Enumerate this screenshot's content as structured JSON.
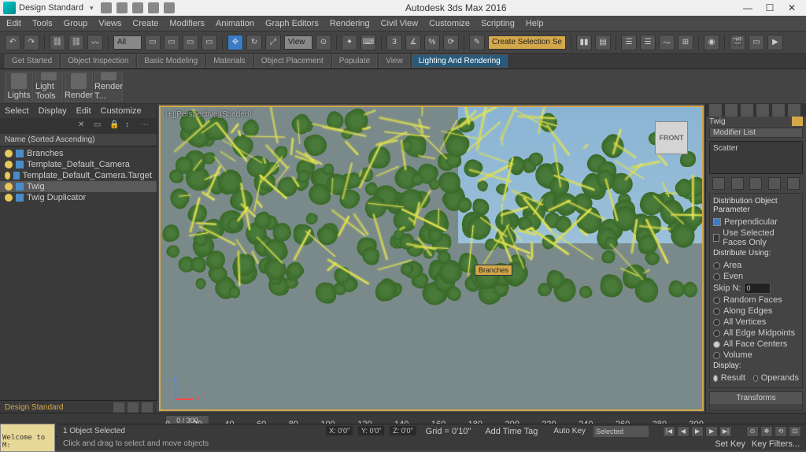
{
  "titlebar": {
    "workspace": "Design Standard",
    "title": "Autodesk 3ds Max 2016"
  },
  "menus": [
    "Edit",
    "Tools",
    "Group",
    "Views",
    "Create",
    "Modifiers",
    "Animation",
    "Graph Editors",
    "Rendering",
    "Civil View",
    "Customize",
    "Scripting",
    "Help"
  ],
  "toolbar": {
    "all": "All",
    "view": "View",
    "selset": "Create Selection Se"
  },
  "tabs": [
    "Get Started",
    "Object Inspection",
    "Basic Modeling",
    "Materials",
    "Object Placement",
    "Populate",
    "View",
    "Lighting And Rendering"
  ],
  "active_tab": "Lighting And Rendering",
  "ribbon": [
    "Lights",
    "Light Tools",
    "Render",
    "Render T..."
  ],
  "leftmenus": [
    "Select",
    "Display",
    "Edit",
    "Customize"
  ],
  "list_header": "Name (Sorted Ascending)",
  "scene_items": [
    {
      "name": "Branches",
      "sel": false
    },
    {
      "name": "Template_Default_Camera",
      "sel": false
    },
    {
      "name": "Template_Default_Camera.Target",
      "sel": false
    },
    {
      "name": "Twig",
      "sel": true
    },
    {
      "name": "Twig Duplicator",
      "sel": false
    }
  ],
  "viewport": {
    "label": "[+][Perspective][Shaded]",
    "cube": "FRONT",
    "tag": "Branches"
  },
  "right": {
    "objname": "Twig",
    "modlist": "Modifier List",
    "stack": [
      "Scatter"
    ],
    "section1": {
      "title": "Distribution Object Parameter",
      "perpendicular": "Perpendicular",
      "usesel": "Use Selected Faces Only"
    },
    "distribute": {
      "title": "Distribute Using:",
      "opts": [
        "Area",
        "Even"
      ],
      "skip": "Skip N:",
      "skipval": "0",
      "opts2": [
        "Random Faces",
        "Along Edges",
        "All Vertices",
        "All Edge Midpoints",
        "All Face Centers",
        "Volume"
      ],
      "selected": "All Face Centers"
    },
    "display": {
      "title": "Display:",
      "result": "Result",
      "operands": "Operands"
    },
    "transforms": "Transforms"
  },
  "timeline": {
    "frame": "0 / 300",
    "ticks": [
      "0",
      "20",
      "40",
      "60",
      "80",
      "100",
      "120",
      "140",
      "160",
      "180",
      "200",
      "220",
      "240",
      "260",
      "280",
      "300"
    ]
  },
  "status": {
    "selected": "1 Object Selected",
    "x": "X: 0'0\"",
    "y": "Y: 0'0\"",
    "z": "Z: 0'0\"",
    "grid": "Grid = 0'10\"",
    "autokey": "Auto Key",
    "selmode": "Selected",
    "setkey": "Set Key",
    "keyf": "Key Filters...",
    "addtag": "Add Time Tag",
    "hint": "Click and drag to select and move objects",
    "welcome": "Welcome to M:"
  },
  "leftfoot": {
    "ws": "Design Standard"
  }
}
